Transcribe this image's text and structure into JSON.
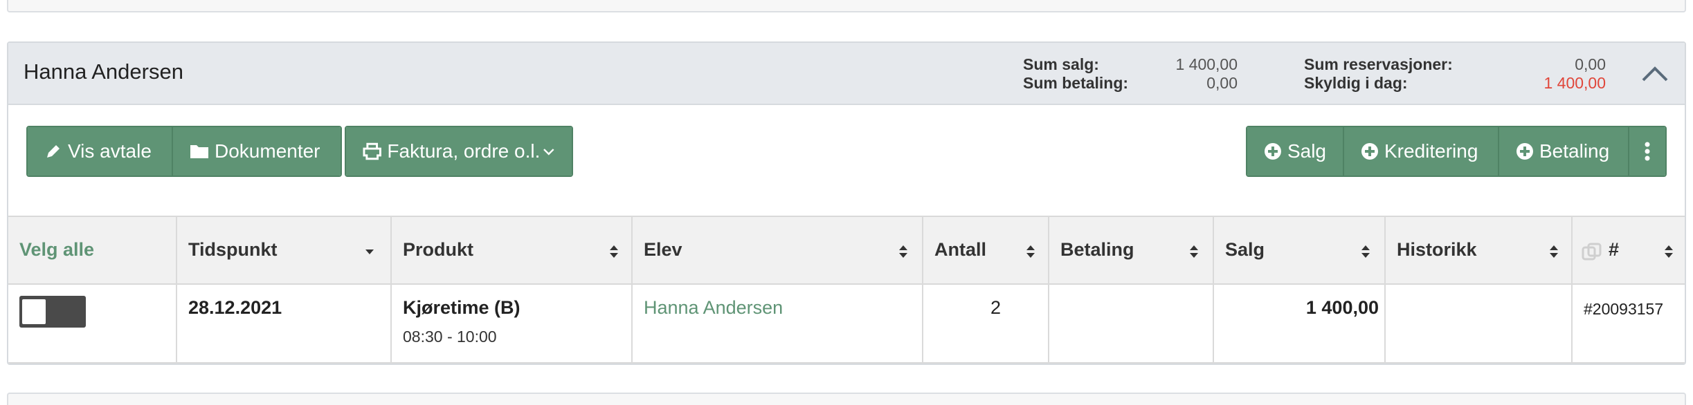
{
  "customer": {
    "name": "Hanna Andersen"
  },
  "sums": {
    "sales_label": "Sum salg:",
    "sales_value": "1 400,00",
    "payment_label": "Sum betaling:",
    "payment_value": "0,00",
    "reservations_label": "Sum reservasjoner:",
    "reservations_value": "0,00",
    "owed_label": "Skyldig i dag:",
    "owed_value": "1 400,00",
    "owed_color": "#e0463a"
  },
  "toolbar_left": {
    "show_agreement": "Vis avtale",
    "documents": "Dokumenter",
    "invoice": "Faktura, ordre o.l."
  },
  "toolbar_right": {
    "sale": "Salg",
    "credit": "Kreditering",
    "payment": "Betaling"
  },
  "table": {
    "columns": [
      "Velg alle",
      "Tidspunkt",
      "Produkt",
      "Elev",
      "Antall",
      "Betaling",
      "Salg",
      "Historikk",
      "#"
    ],
    "rows": [
      {
        "date": "28.12.2021",
        "product": "Kjøretime (B)",
        "time": "08:30 - 10:00",
        "student": "Hanna Andersen",
        "quantity": "2",
        "payment": "",
        "sale": "1 400,00",
        "history": "",
        "number": "#20093157"
      }
    ]
  },
  "colors": {
    "accent": "#5f9475",
    "header_bg": "#e6e9ed"
  }
}
